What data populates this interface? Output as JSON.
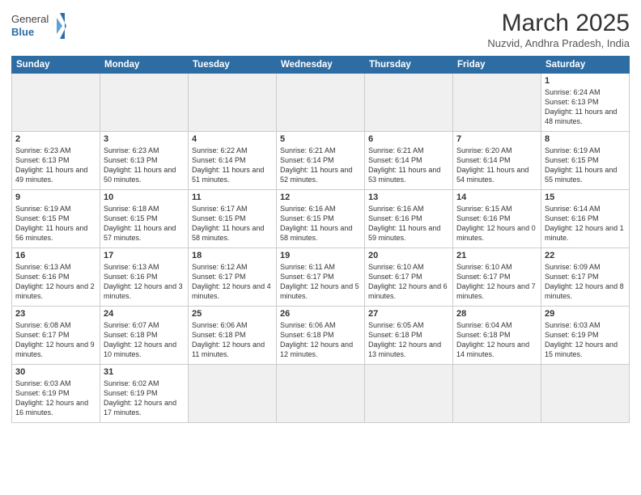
{
  "header": {
    "logo_text_normal": "General",
    "logo_text_bold": "Blue",
    "month_title": "March 2025",
    "location": "Nuzvid, Andhra Pradesh, India"
  },
  "weekdays": [
    "Sunday",
    "Monday",
    "Tuesday",
    "Wednesday",
    "Thursday",
    "Friday",
    "Saturday"
  ],
  "days": {
    "d1": {
      "num": "1",
      "sunrise": "6:24 AM",
      "sunset": "6:13 PM",
      "daylight": "11 hours and 48 minutes."
    },
    "d2": {
      "num": "2",
      "sunrise": "6:23 AM",
      "sunset": "6:13 PM",
      "daylight": "11 hours and 49 minutes."
    },
    "d3": {
      "num": "3",
      "sunrise": "6:23 AM",
      "sunset": "6:13 PM",
      "daylight": "11 hours and 50 minutes."
    },
    "d4": {
      "num": "4",
      "sunrise": "6:22 AM",
      "sunset": "6:14 PM",
      "daylight": "11 hours and 51 minutes."
    },
    "d5": {
      "num": "5",
      "sunrise": "6:21 AM",
      "sunset": "6:14 PM",
      "daylight": "11 hours and 52 minutes."
    },
    "d6": {
      "num": "6",
      "sunrise": "6:21 AM",
      "sunset": "6:14 PM",
      "daylight": "11 hours and 53 minutes."
    },
    "d7": {
      "num": "7",
      "sunrise": "6:20 AM",
      "sunset": "6:14 PM",
      "daylight": "11 hours and 54 minutes."
    },
    "d8": {
      "num": "8",
      "sunrise": "6:19 AM",
      "sunset": "6:15 PM",
      "daylight": "11 hours and 55 minutes."
    },
    "d9": {
      "num": "9",
      "sunrise": "6:19 AM",
      "sunset": "6:15 PM",
      "daylight": "11 hours and 56 minutes."
    },
    "d10": {
      "num": "10",
      "sunrise": "6:18 AM",
      "sunset": "6:15 PM",
      "daylight": "11 hours and 57 minutes."
    },
    "d11": {
      "num": "11",
      "sunrise": "6:17 AM",
      "sunset": "6:15 PM",
      "daylight": "11 hours and 58 minutes."
    },
    "d12": {
      "num": "12",
      "sunrise": "6:16 AM",
      "sunset": "6:15 PM",
      "daylight": "11 hours and 58 minutes."
    },
    "d13": {
      "num": "13",
      "sunrise": "6:16 AM",
      "sunset": "6:16 PM",
      "daylight": "11 hours and 59 minutes."
    },
    "d14": {
      "num": "14",
      "sunrise": "6:15 AM",
      "sunset": "6:16 PM",
      "daylight": "12 hours and 0 minutes."
    },
    "d15": {
      "num": "15",
      "sunrise": "6:14 AM",
      "sunset": "6:16 PM",
      "daylight": "12 hours and 1 minute."
    },
    "d16": {
      "num": "16",
      "sunrise": "6:13 AM",
      "sunset": "6:16 PM",
      "daylight": "12 hours and 2 minutes."
    },
    "d17": {
      "num": "17",
      "sunrise": "6:13 AM",
      "sunset": "6:16 PM",
      "daylight": "12 hours and 3 minutes."
    },
    "d18": {
      "num": "18",
      "sunrise": "6:12 AM",
      "sunset": "6:17 PM",
      "daylight": "12 hours and 4 minutes."
    },
    "d19": {
      "num": "19",
      "sunrise": "6:11 AM",
      "sunset": "6:17 PM",
      "daylight": "12 hours and 5 minutes."
    },
    "d20": {
      "num": "20",
      "sunrise": "6:10 AM",
      "sunset": "6:17 PM",
      "daylight": "12 hours and 6 minutes."
    },
    "d21": {
      "num": "21",
      "sunrise": "6:10 AM",
      "sunset": "6:17 PM",
      "daylight": "12 hours and 7 minutes."
    },
    "d22": {
      "num": "22",
      "sunrise": "6:09 AM",
      "sunset": "6:17 PM",
      "daylight": "12 hours and 8 minutes."
    },
    "d23": {
      "num": "23",
      "sunrise": "6:08 AM",
      "sunset": "6:17 PM",
      "daylight": "12 hours and 9 minutes."
    },
    "d24": {
      "num": "24",
      "sunrise": "6:07 AM",
      "sunset": "6:18 PM",
      "daylight": "12 hours and 10 minutes."
    },
    "d25": {
      "num": "25",
      "sunrise": "6:06 AM",
      "sunset": "6:18 PM",
      "daylight": "12 hours and 11 minutes."
    },
    "d26": {
      "num": "26",
      "sunrise": "6:06 AM",
      "sunset": "6:18 PM",
      "daylight": "12 hours and 12 minutes."
    },
    "d27": {
      "num": "27",
      "sunrise": "6:05 AM",
      "sunset": "6:18 PM",
      "daylight": "12 hours and 13 minutes."
    },
    "d28": {
      "num": "28",
      "sunrise": "6:04 AM",
      "sunset": "6:18 PM",
      "daylight": "12 hours and 14 minutes."
    },
    "d29": {
      "num": "29",
      "sunrise": "6:03 AM",
      "sunset": "6:19 PM",
      "daylight": "12 hours and 15 minutes."
    },
    "d30": {
      "num": "30",
      "sunrise": "6:03 AM",
      "sunset": "6:19 PM",
      "daylight": "12 hours and 16 minutes."
    },
    "d31": {
      "num": "31",
      "sunrise": "6:02 AM",
      "sunset": "6:19 PM",
      "daylight": "12 hours and 17 minutes."
    }
  },
  "labels": {
    "sunrise": "Sunrise:",
    "sunset": "Sunset:",
    "daylight": "Daylight:"
  }
}
